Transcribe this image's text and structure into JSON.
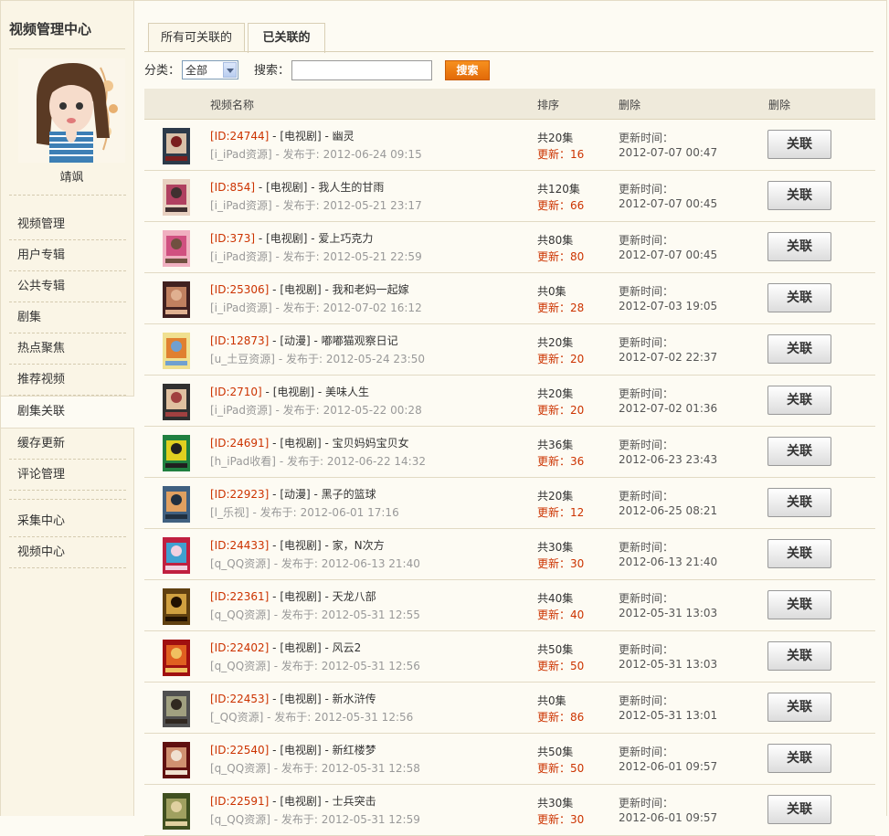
{
  "sidebar": {
    "title": "视频管理中心",
    "user_name": "靖飒",
    "menu": [
      "视频管理",
      "用户专辑",
      "公共专辑",
      "剧集",
      "热点聚焦",
      "推荐视频",
      "剧集关联",
      "缓存更新",
      "评论管理"
    ],
    "menu2": [
      "采集中心",
      "视频中心"
    ],
    "active_index": 6
  },
  "tabs": [
    "所有可关联的",
    "已关联的"
  ],
  "filter": {
    "category_label": "分类：",
    "category_value": "全部",
    "search_label": "搜索：",
    "search_value": "",
    "search_button": "搜索"
  },
  "table": {
    "headers": [
      "视频名称",
      "排序",
      "删除",
      "删除"
    ],
    "rows": [
      {
        "id": "[ID:24744]",
        "cat": "[电视剧]",
        "title": "幽灵",
        "src": "[i_iPad资源]",
        "pub": "2012-06-24 09:15",
        "total": "共20集",
        "upd": "更新：16",
        "time": "2012-07-07 00:47"
      },
      {
        "id": "[ID:854]",
        "cat": "[电视剧]",
        "title": "我人生的甘雨",
        "src": "[i_iPad资源]",
        "pub": "2012-05-21 23:17",
        "total": "共120集",
        "upd": "更新：66",
        "time": "2012-07-07 00:45"
      },
      {
        "id": "[ID:373]",
        "cat": "[电视剧]",
        "title": "爱上巧克力",
        "src": "[i_iPad资源]",
        "pub": "2012-05-21 22:59",
        "total": "共80集",
        "upd": "更新：80",
        "time": "2012-07-07 00:45"
      },
      {
        "id": "[ID:25306]",
        "cat": "[电视剧]",
        "title": "我和老妈一起嫁",
        "src": "[i_iPad资源]",
        "pub": "2012-07-02 16:12",
        "total": "共0集",
        "upd": "更新：28",
        "time": "2012-07-03 19:05"
      },
      {
        "id": "[ID:12873]",
        "cat": "[动漫]",
        "title": "嘟嘟猫观察日记",
        "src": "[u_土豆资源]",
        "pub": "2012-05-24 23:50",
        "total": "共20集",
        "upd": "更新：20",
        "time": "2012-07-02 22:37"
      },
      {
        "id": "[ID:2710]",
        "cat": "[电视剧]",
        "title": "美味人生",
        "src": "[i_iPad资源]",
        "pub": "2012-05-22 00:28",
        "total": "共20集",
        "upd": "更新：20",
        "time": "2012-07-02 01:36"
      },
      {
        "id": "[ID:24691]",
        "cat": "[电视剧]",
        "title": "宝贝妈妈宝贝女",
        "src": "[h_iPad收看]",
        "pub": "2012-06-22 14:32",
        "total": "共36集",
        "upd": "更新：36",
        "time": "2012-06-23 23:43"
      },
      {
        "id": "[ID:22923]",
        "cat": "[动漫]",
        "title": "黑子的篮球",
        "src": "[l_乐视]",
        "pub": "2012-06-01 17:16",
        "total": "共20集",
        "upd": "更新：12",
        "time": "2012-06-25 08:21"
      },
      {
        "id": "[ID:24433]",
        "cat": "[电视剧]",
        "title": "家，N次方",
        "src": "[q_QQ资源]",
        "pub": "2012-06-13 21:40",
        "total": "共30集",
        "upd": "更新：30",
        "time": "2012-06-13 21:40"
      },
      {
        "id": "[ID:22361]",
        "cat": "[电视剧]",
        "title": "天龙八部",
        "src": "[q_QQ资源]",
        "pub": "2012-05-31 12:55",
        "total": "共40集",
        "upd": "更新：40",
        "time": "2012-05-31 13:03"
      },
      {
        "id": "[ID:22402]",
        "cat": "[电视剧]",
        "title": "风云2",
        "src": "[q_QQ资源]",
        "pub": "2012-05-31 12:56",
        "total": "共50集",
        "upd": "更新：50",
        "time": "2012-05-31 13:03"
      },
      {
        "id": "[ID:22453]",
        "cat": "[电视剧]",
        "title": "新水浒传",
        "src": "[_QQ资源]",
        "pub": "2012-05-31 12:56",
        "total": "共0集",
        "upd": "更新：86",
        "time": "2012-05-31 13:01"
      },
      {
        "id": "[ID:22540]",
        "cat": "[电视剧]",
        "title": "新红楼梦",
        "src": "[q_QQ资源]",
        "pub": "2012-05-31 12:58",
        "total": "共50集",
        "upd": "更新：50",
        "time": "2012-06-01 09:57"
      },
      {
        "id": "[ID:22591]",
        "cat": "[电视剧]",
        "title": "士兵突击",
        "src": "[q_QQ资源]",
        "pub": "2012-05-31 12:59",
        "total": "共30集",
        "upd": "更新：30",
        "time": "2012-06-01 09:57"
      }
    ],
    "pub_prefix": "- 发布于:",
    "time_label": "更新时间：",
    "action_label": "关联"
  },
  "colors": {
    "accent": "#cc3300",
    "button_orange": "#f28a1a",
    "sidebar_bg": "#faf5e6"
  },
  "icons": [
    "poster-thumbnail",
    "dropdown-arrow-icon"
  ]
}
